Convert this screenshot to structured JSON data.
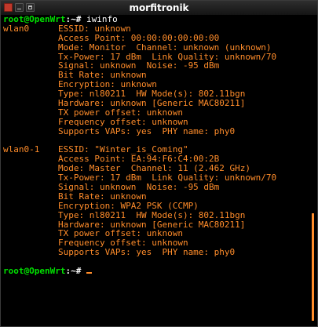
{
  "window": {
    "title": "morfitronik",
    "accent": "#ff8c2a",
    "prompt_color": "#00e000"
  },
  "session": {
    "prompt_user": "root@OpenWrt",
    "prompt_path": ":~",
    "prompt_symbol": "#",
    "command": "iwinfo"
  },
  "interfaces": [
    {
      "name": "wlan0",
      "lines": [
        "ESSID: unknown",
        "Access Point: 00:00:00:00:00:00",
        "Mode: Monitor  Channel: unknown (unknown)",
        "Tx-Power: 17 dBm  Link Quality: unknown/70",
        "Signal: unknown  Noise: -95 dBm",
        "Bit Rate: unknown",
        "Encryption: unknown",
        "Type: nl80211  HW Mode(s): 802.11bgn",
        "Hardware: unknown [Generic MAC80211]",
        "TX power offset: unknown",
        "Frequency offset: unknown",
        "Supports VAPs: yes  PHY name: phy0"
      ]
    },
    {
      "name": "wlan0-1",
      "lines": [
        "ESSID: \"Winter_is_Coming\"",
        "Access Point: EA:94:F6:C4:00:2B",
        "Mode: Master  Channel: 11 (2.462 GHz)",
        "Tx-Power: 17 dBm  Link Quality: unknown/70",
        "Signal: unknown  Noise: -95 dBm",
        "Bit Rate: unknown",
        "Encryption: WPA2 PSK (CCMP)",
        "Type: nl80211  HW Mode(s): 802.11bgn",
        "Hardware: unknown [Generic MAC80211]",
        "TX power offset: unknown",
        "Frequency offset: unknown",
        "Supports VAPs: yes  PHY name: phy0"
      ]
    }
  ]
}
